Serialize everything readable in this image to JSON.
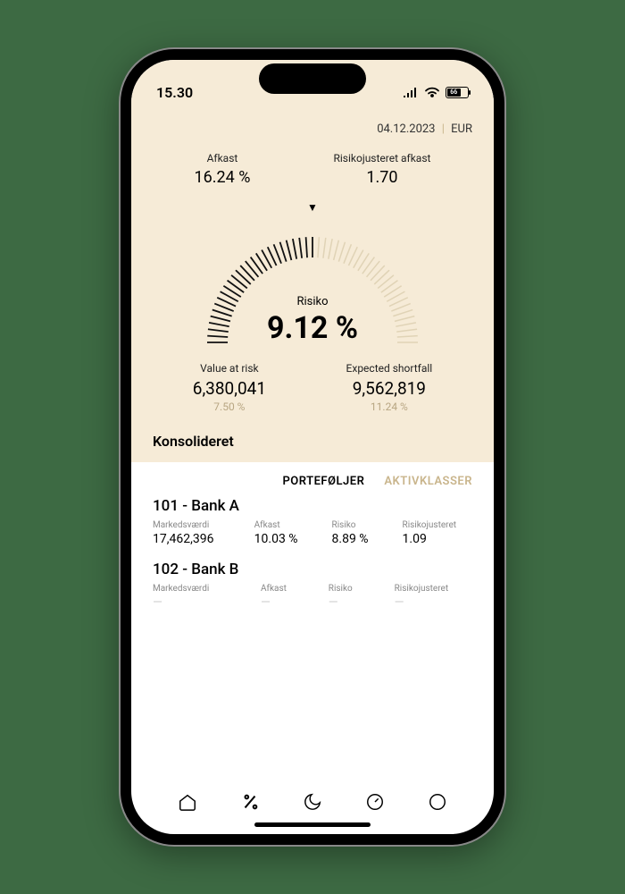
{
  "status": {
    "time": "15.30",
    "battery_pct": "66"
  },
  "header": {
    "date": "04.12.2023",
    "currency": "EUR"
  },
  "metrics": {
    "return_label": "Afkast",
    "return_value": "16.24 %",
    "riskadj_label": "Risikojusteret afkast",
    "riskadj_value": "1.70"
  },
  "gauge": {
    "label": "Risiko",
    "value": "9.12 %"
  },
  "var": {
    "label": "Value at risk",
    "value": "6,380,041",
    "pct": "7.50 %"
  },
  "es": {
    "label": "Expected shortfall",
    "value": "9,562,819",
    "pct": "11.24 %"
  },
  "section_title": "Konsolideret",
  "tabs": {
    "a": "PORTEFØLJER",
    "b": "AKTIVKLASSER"
  },
  "cols": {
    "mv": "Markedsværdi",
    "ret": "Afkast",
    "risk": "Risiko",
    "radj": "Risikojusteret"
  },
  "rows": [
    {
      "title": "101 - Bank A",
      "mv": "17,462,396",
      "ret": "10.03 %",
      "risk": "8.89 %",
      "radj": "1.09"
    },
    {
      "title": "102 - Bank B"
    }
  ]
}
